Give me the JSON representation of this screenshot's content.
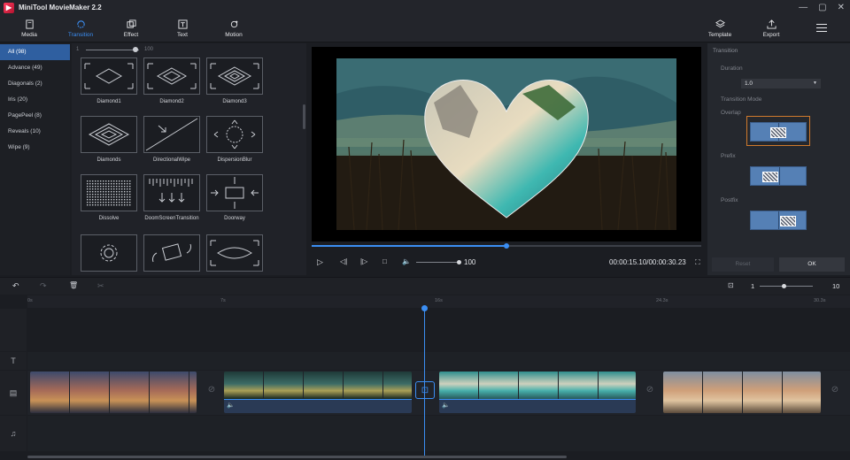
{
  "app": {
    "title": "MiniTool MovieMaker 2.2",
    "logo_letter": "▶"
  },
  "window_controls": [
    "—",
    "▢",
    "✕"
  ],
  "toolbar": {
    "items": [
      {
        "label": "Media",
        "icon": "media-icon"
      },
      {
        "label": "Transition",
        "icon": "transition-icon",
        "active": true
      },
      {
        "label": "Effect",
        "icon": "effect-icon"
      },
      {
        "label": "Text",
        "icon": "text-icon"
      },
      {
        "label": "Motion",
        "icon": "motion-icon"
      }
    ],
    "right_items": [
      {
        "label": "Template",
        "icon": "template-icon"
      },
      {
        "label": "Export",
        "icon": "export-icon"
      }
    ]
  },
  "categories": [
    {
      "label": "All (98)",
      "active": true
    },
    {
      "label": "Advance (49)"
    },
    {
      "label": "Diagonals (2)"
    },
    {
      "label": "Iris (20)"
    },
    {
      "label": "PagePeel (8)"
    },
    {
      "label": "Reveals (10)"
    },
    {
      "label": "Wipe (9)"
    }
  ],
  "zoom": {
    "min": "1",
    "max": "100"
  },
  "transitions": [
    {
      "label": "Diamond1",
      "icon": "diamond-icon"
    },
    {
      "label": "Diamond2",
      "icon": "diamond-icon"
    },
    {
      "label": "Diamond3",
      "icon": "diamond-icon"
    },
    {
      "label": "Diamonds",
      "icon": "diamonds-icon"
    },
    {
      "label": "DirectionalWipe",
      "icon": "directional-wipe-icon"
    },
    {
      "label": "DispersionBlur",
      "icon": "dispersion-blur-icon"
    },
    {
      "label": "Dissolve",
      "icon": "dissolve-icon"
    },
    {
      "label": "DoomScreenTransition",
      "icon": "doom-screen-icon"
    },
    {
      "label": "Doorway",
      "icon": "doorway-icon"
    },
    {
      "label": "",
      "icon": "gear-transition-icon"
    },
    {
      "label": "",
      "icon": "rotate-transition-icon"
    },
    {
      "label": "",
      "icon": "eye-transition-icon"
    }
  ],
  "player": {
    "progress": 0.5,
    "volume": "100",
    "volume_level": 1.0,
    "timecode": "00:00:15.10/00:00:30.23"
  },
  "transition_panel": {
    "title": "Transition",
    "duration_label": "Duration",
    "duration_value": "1.0",
    "mode_label": "Transition Mode",
    "modes": [
      {
        "label": "Overlap",
        "active": true
      },
      {
        "label": "Prefix"
      },
      {
        "label": "Postfix"
      }
    ],
    "reset_label": "Reset",
    "ok_label": "OK"
  },
  "timeline": {
    "zoom_min": "1",
    "zoom_max": "10",
    "zoom_level": 0.45,
    "ruler_ticks": [
      "0s",
      "7s",
      "16s",
      "24.3s",
      "30.3s"
    ],
    "clip_colors": {
      "city": [
        "#3d4a6c",
        "#a56a58",
        "#c89257",
        "#2b2d3d"
      ],
      "grass": [
        "#1f3a38",
        "#3c6c66",
        "#aba057",
        "#142520"
      ],
      "beach": [
        "#2f8f8e",
        "#cfd1bd",
        "#47b0ab",
        "#27595b"
      ],
      "balloon": [
        "#7f8ea0",
        "#cf9f79",
        "#e0c4a0",
        "#5a4a3a"
      ]
    }
  }
}
